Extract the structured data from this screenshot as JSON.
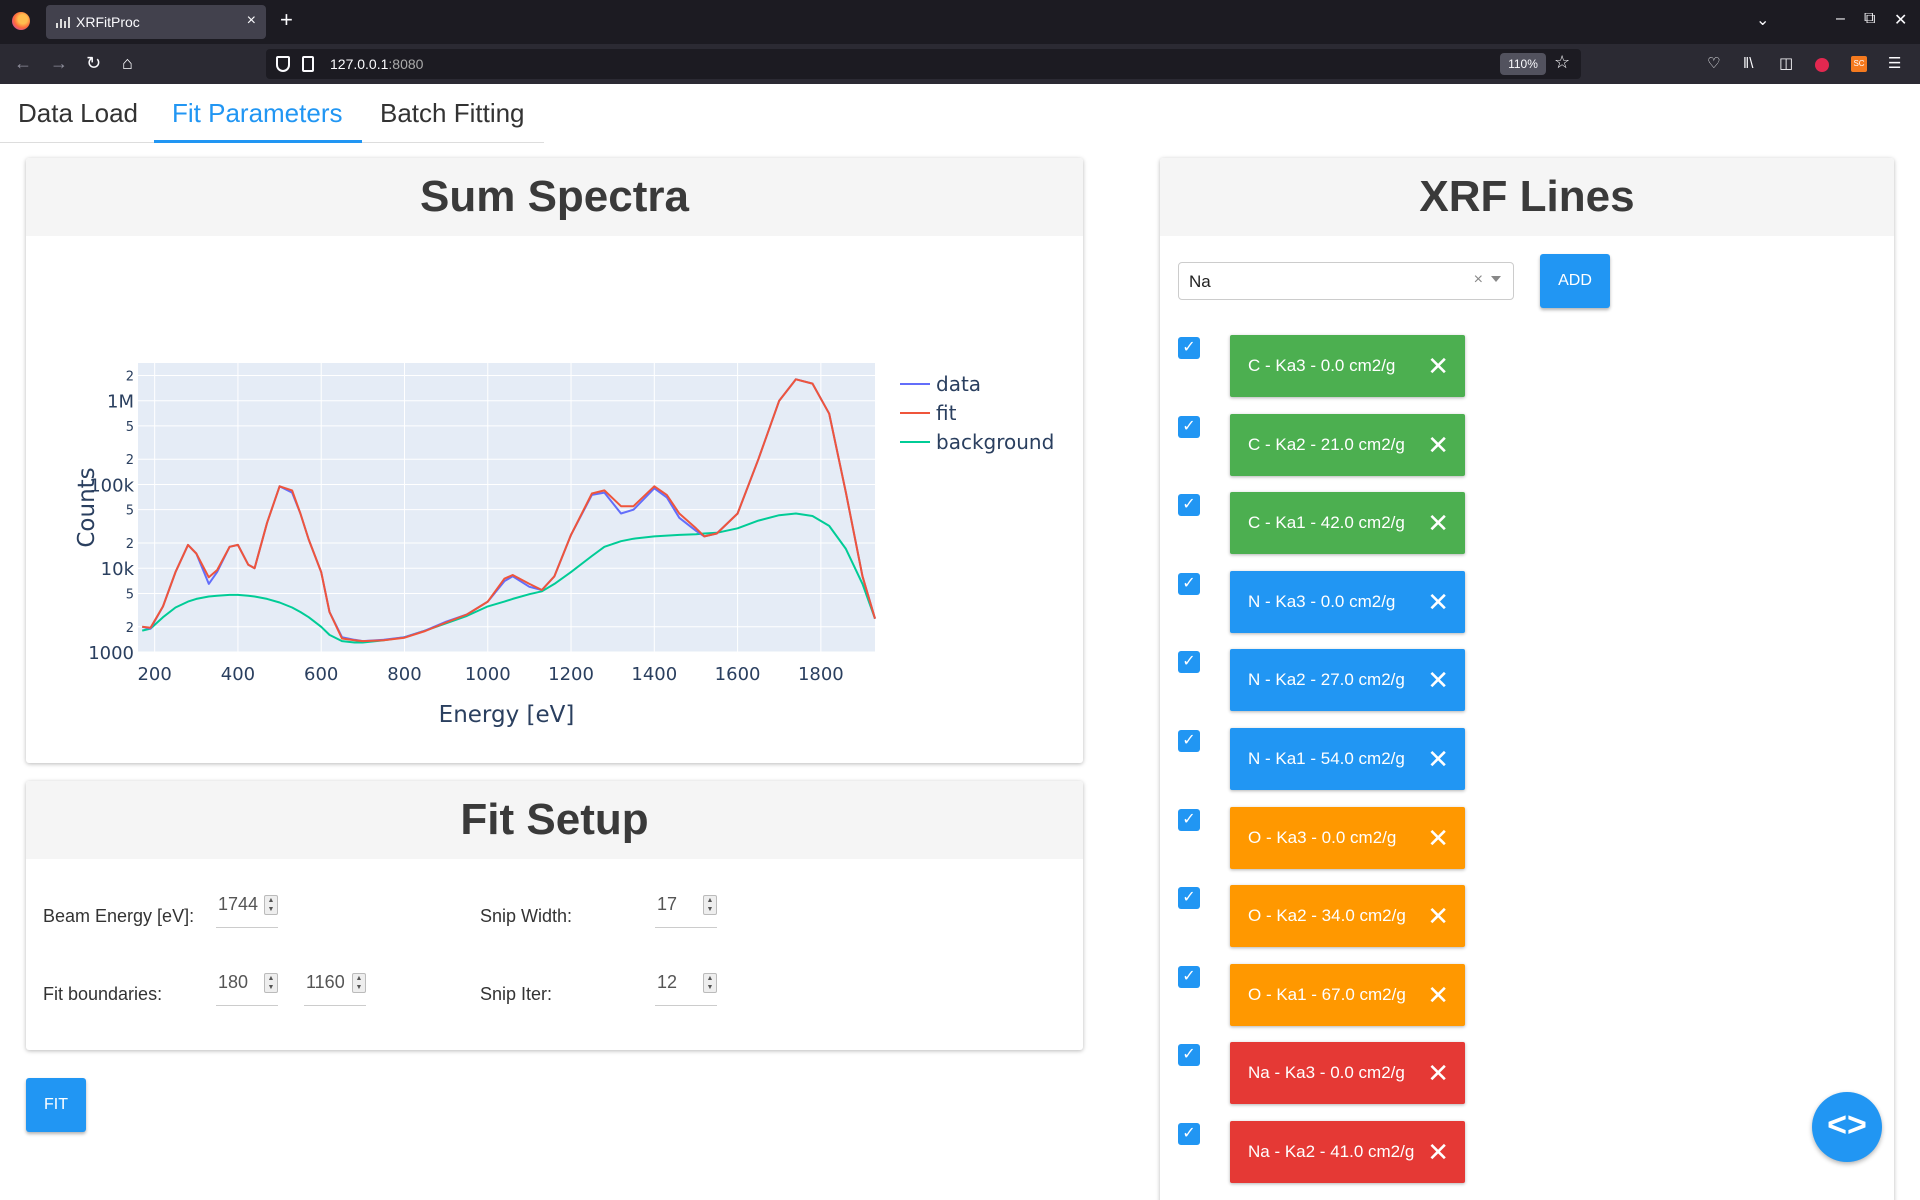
{
  "browser": {
    "tab_title": "XRFitProc",
    "tab_close": "×",
    "new_tab": "+",
    "url_host": "127.0.0.1",
    "url_port": ":8080",
    "zoom": "110%"
  },
  "app_tabs": [
    {
      "label": "Data Load",
      "active": false
    },
    {
      "label": "Fit Parameters",
      "active": true
    },
    {
      "label": "Batch Fitting",
      "active": false
    }
  ],
  "spectra": {
    "title": "Sum Spectra"
  },
  "chart_data": {
    "type": "line",
    "title": "",
    "xlabel": "Energy [eV]",
    "ylabel": "Counts",
    "xlim": [
      160,
      1930
    ],
    "ylim_log10": [
      3,
      6.45
    ],
    "y_scale": "log",
    "grid": true,
    "legend_position": "top-right",
    "x_ticks": [
      200,
      400,
      600,
      800,
      1000,
      1200,
      1400,
      1600,
      1800
    ],
    "y_ticks": [
      {
        "value": 1000,
        "label": "1000"
      },
      {
        "value": 2000,
        "label": "2"
      },
      {
        "value": 5000,
        "label": "5"
      },
      {
        "value": 10000,
        "label": "10k"
      },
      {
        "value": 20000,
        "label": "2"
      },
      {
        "value": 50000,
        "label": "5"
      },
      {
        "value": 100000,
        "label": "100k"
      },
      {
        "value": 200000,
        "label": "2"
      },
      {
        "value": 500000,
        "label": "5"
      },
      {
        "value": 1000000,
        "label": "1M"
      },
      {
        "value": 2000000,
        "label": "2"
      }
    ],
    "x": [
      170,
      190,
      220,
      250,
      280,
      300,
      330,
      350,
      380,
      400,
      425,
      440,
      470,
      500,
      530,
      550,
      570,
      600,
      620,
      650,
      680,
      700,
      750,
      800,
      850,
      900,
      950,
      1000,
      1040,
      1060,
      1100,
      1130,
      1160,
      1200,
      1250,
      1280,
      1320,
      1350,
      1400,
      1430,
      1460,
      1500,
      1520,
      1550,
      1600,
      1650,
      1700,
      1740,
      1780,
      1820,
      1860,
      1900,
      1930
    ],
    "series": [
      {
        "name": "data",
        "color": "#636efa",
        "values": [
          2000,
          1900,
          3500,
          9000,
          19000,
          15000,
          6500,
          9000,
          18000,
          19000,
          11000,
          10000,
          35000,
          95000,
          80000,
          45000,
          22000,
          9000,
          3000,
          1500,
          1400,
          1350,
          1400,
          1500,
          1800,
          2300,
          2800,
          4000,
          7000,
          8000,
          6000,
          5500,
          8000,
          25000,
          75000,
          80000,
          45000,
          50000,
          90000,
          70000,
          40000,
          28000,
          24000,
          26000,
          45000,
          200000,
          1000000,
          1800000,
          1600000,
          700000,
          80000,
          8000,
          2500
        ]
      },
      {
        "name": "fit",
        "color": "#ef553b",
        "values": [
          2000,
          1950,
          3500,
          9000,
          19000,
          15000,
          7800,
          9500,
          18000,
          19000,
          11000,
          10000,
          35000,
          95000,
          85000,
          45000,
          22000,
          9000,
          3000,
          1450,
          1380,
          1350,
          1380,
          1480,
          1780,
          2250,
          2800,
          4000,
          7500,
          8300,
          6500,
          5500,
          8000,
          25000,
          78000,
          85000,
          55000,
          55000,
          95000,
          75000,
          45000,
          30000,
          24000,
          26000,
          45000,
          200000,
          1000000,
          1800000,
          1600000,
          700000,
          80000,
          8000,
          2500
        ]
      },
      {
        "name": "background",
        "color": "#00cc96",
        "values": [
          1800,
          1900,
          2600,
          3400,
          4000,
          4300,
          4600,
          4700,
          4800,
          4800,
          4700,
          4600,
          4300,
          3900,
          3400,
          3000,
          2600,
          2000,
          1600,
          1350,
          1300,
          1300,
          1380,
          1500,
          1800,
          2200,
          2700,
          3500,
          4000,
          4300,
          4900,
          5300,
          6500,
          9000,
          14000,
          18000,
          21000,
          22500,
          24000,
          24500,
          25000,
          25500,
          26000,
          26500,
          30000,
          37000,
          43000,
          45000,
          42000,
          32000,
          17000,
          6500,
          2500
        ]
      }
    ]
  },
  "setup": {
    "title": "Fit Setup",
    "beam_energy_label": "Beam Energy [eV]:",
    "beam_energy": "1744",
    "fit_boundaries_label": "Fit boundaries:",
    "fit_low": "180",
    "fit_high": "1160",
    "snip_width_label": "Snip Width:",
    "snip_width": "17",
    "snip_iter_label": "Snip Iter:",
    "snip_iter": "12",
    "fit_button": "FIT"
  },
  "xrf": {
    "title": "XRF Lines",
    "select_value": "Na",
    "clear_symbol": "×",
    "add_button": "ADD",
    "lines": [
      {
        "label": "C - Ka3 - 0.0 cm2/g",
        "color": "#4caf50",
        "checked": true
      },
      {
        "label": "C - Ka2 - 21.0 cm2/g",
        "color": "#4caf50",
        "checked": true
      },
      {
        "label": "C - Ka1 - 42.0 cm2/g",
        "color": "#4caf50",
        "checked": true
      },
      {
        "label": "N - Ka3 - 0.0 cm2/g",
        "color": "#2196f3",
        "checked": true
      },
      {
        "label": "N - Ka2 - 27.0 cm2/g",
        "color": "#2196f3",
        "checked": true
      },
      {
        "label": "N - Ka1 - 54.0 cm2/g",
        "color": "#2196f3",
        "checked": true
      },
      {
        "label": "O - Ka3 - 0.0 cm2/g",
        "color": "#ff9800",
        "checked": true
      },
      {
        "label": "O - Ka2 - 34.0 cm2/g",
        "color": "#ff9800",
        "checked": true
      },
      {
        "label": "O - Ka1 - 67.0 cm2/g",
        "color": "#ff9800",
        "checked": true
      },
      {
        "label": "Na - Ka3 - 0.0 cm2/g",
        "color": "#e53935",
        "checked": true
      },
      {
        "label": "Na - Ka2 - 41.0 cm2/g",
        "color": "#e53935",
        "checked": true
      }
    ]
  }
}
